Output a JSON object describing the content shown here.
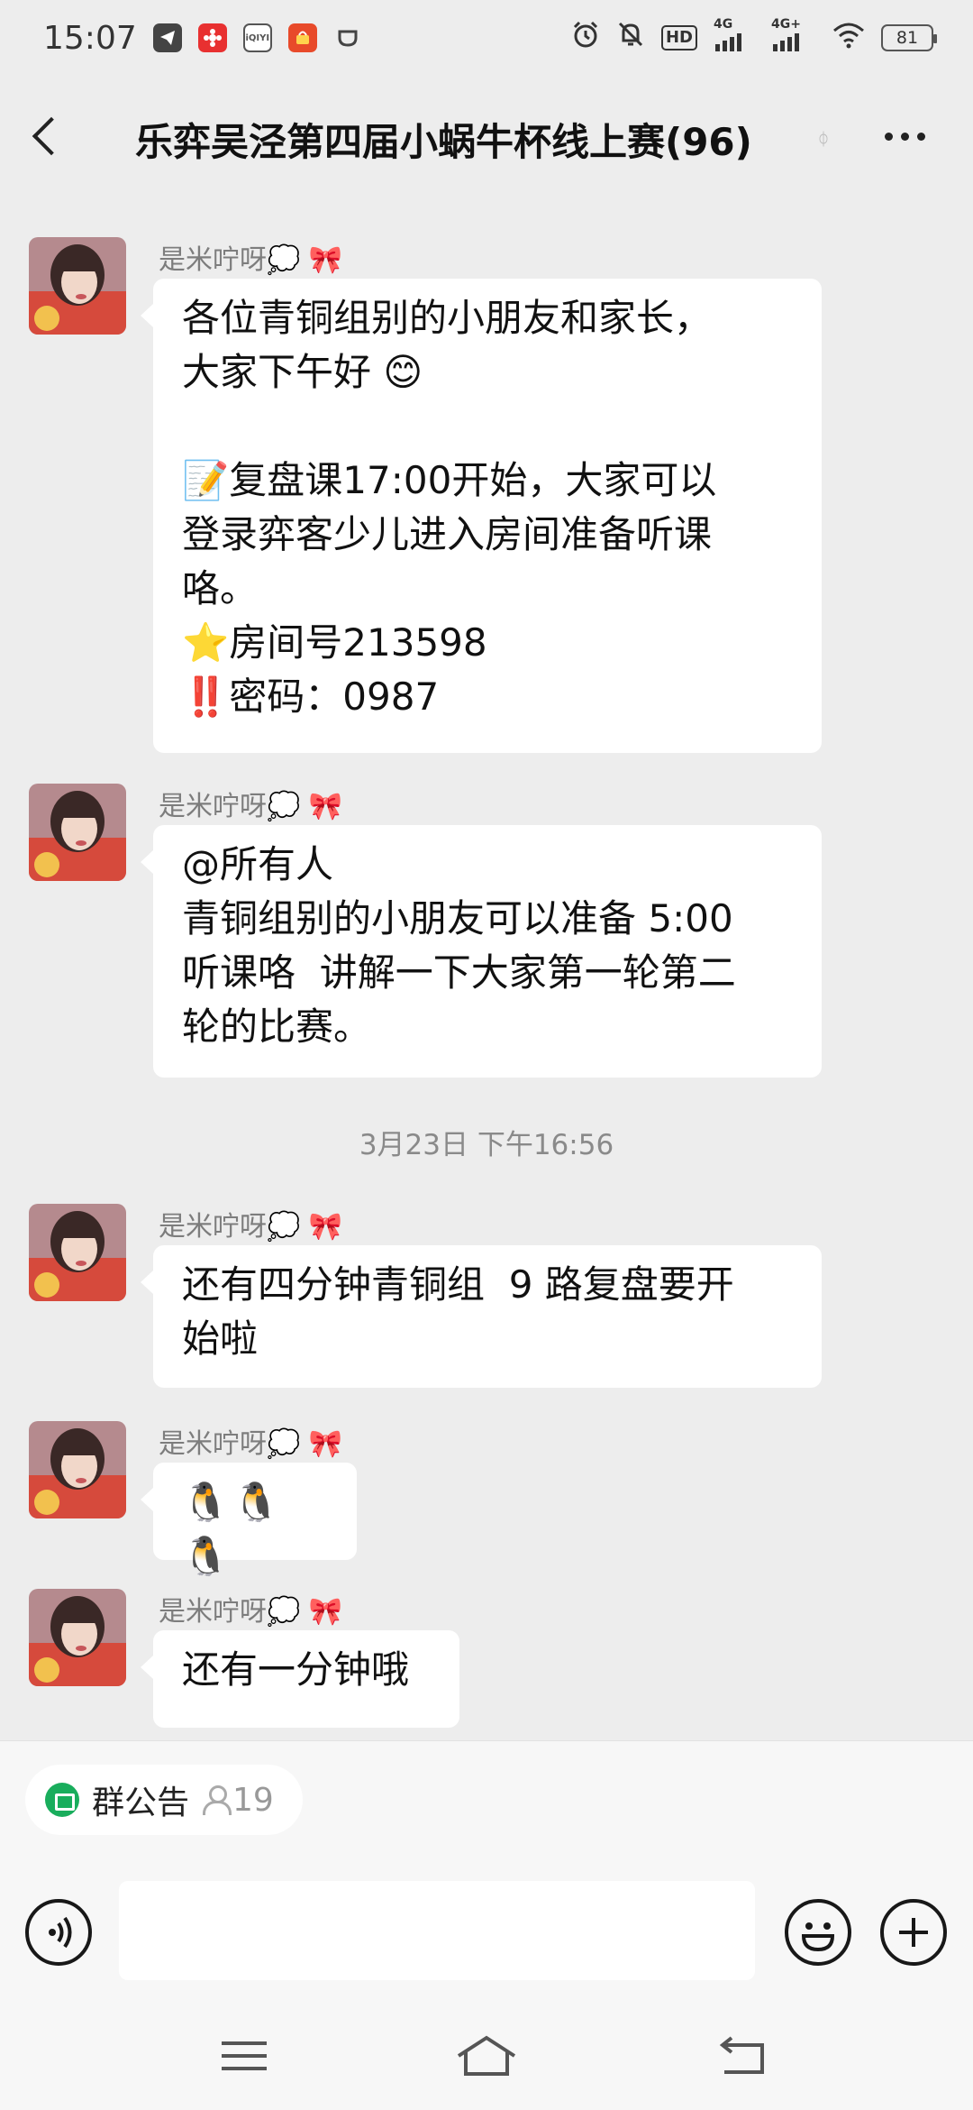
{
  "status_bar": {
    "time": "15:07",
    "app_icons": [
      {
        "name": "telegram-icon",
        "color": "#444444",
        "glyph": ""
      },
      {
        "name": "flower-app-icon",
        "color": "#e83030",
        "glyph": ""
      },
      {
        "name": "iqiyi-icon",
        "color": "#555555",
        "glyph": "iQIYI"
      },
      {
        "name": "shopping-app-icon",
        "color": "#e84a2a",
        "glyph": ""
      },
      {
        "name": "cup-icon",
        "color": "#444444",
        "glyph": ""
      }
    ],
    "hd_label": "HD",
    "sim1_label": "4G",
    "sim2_label": "4G+",
    "battery": "81"
  },
  "header": {
    "title": "乐弈吴泾第四届小蜗牛杯线上赛(96)",
    "mute_mark": "ᛰ"
  },
  "messages": [
    {
      "sender": "是米咛呀💭 🎀",
      "text": "各位青铜组别的小朋友和家长，\n大家下午好 😊\n\n📝复盘课17:00开始，大家可以\n登录弈客少儿进入房间准备听课\n咯。\n⭐房间号213598\n‼️密码：0987"
    },
    {
      "sender": "是米咛呀💭 🎀",
      "text": "@所有人\n青铜组别的小朋友可以准备 5:00\n听课咯  讲解一下大家第一轮第二\n轮的比赛。"
    },
    {
      "sender": "是米咛呀💭 🎀",
      "text": "还有四分钟青铜组  9 路复盘要开\n始啦"
    },
    {
      "sender": "是米咛呀💭 🎀",
      "text": "🐧🐧🐧"
    },
    {
      "sender": "是米咛呀💭 🎀",
      "text": "还有一分钟哦"
    }
  ],
  "timestamp": "3月23日 下午16:56",
  "bottom": {
    "notice_label": "群公告",
    "notice_count": "19",
    "input_value": ""
  }
}
